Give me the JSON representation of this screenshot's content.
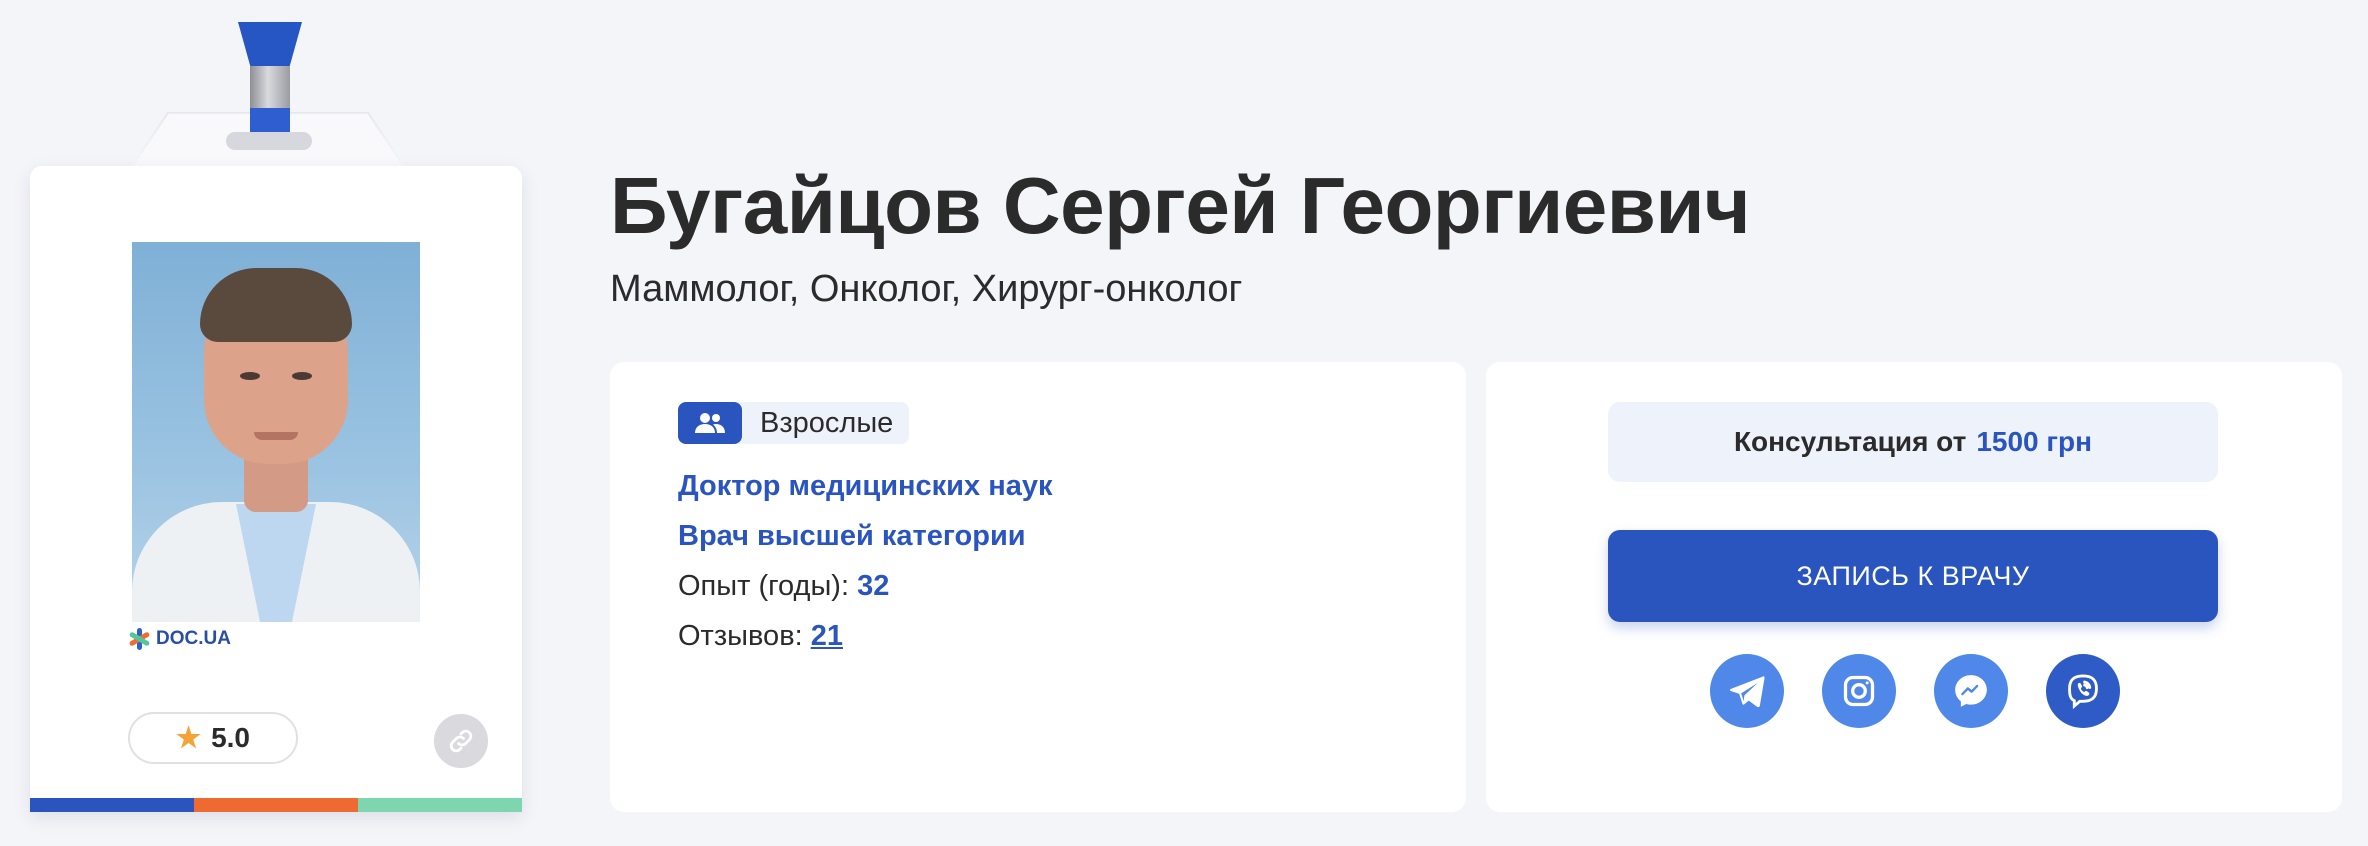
{
  "doctor": {
    "name": "Бугайцов Сергей Георгиевич",
    "specialties": "Маммолог, Онколог, Хирург-онколог"
  },
  "badge": {
    "logo_text": "DOC.UA",
    "rating": "5.0",
    "photo_icon": "doctor-portrait",
    "link_icon": "link-icon"
  },
  "info_panel": {
    "audience_tag": "Взрослые",
    "degree": "Доктор медицинских наук",
    "category": "Врач высшей категории",
    "experience_label": "Опыт (годы):",
    "experience_value": "32",
    "reviews_label": "Отзывов:",
    "reviews_value": "21"
  },
  "booking_panel": {
    "consultation_label": "Консультация от",
    "consultation_price": "1500 грн",
    "book_button": "ЗАПИСЬ К ВРАЧУ",
    "socials": [
      "telegram",
      "instagram",
      "messenger",
      "viber"
    ]
  },
  "colors": {
    "accent": "#2a55bf",
    "orange": "#ef6a33",
    "mint": "#7ed6b0",
    "star": "#f4a23a",
    "background": "#f4f5f9"
  }
}
